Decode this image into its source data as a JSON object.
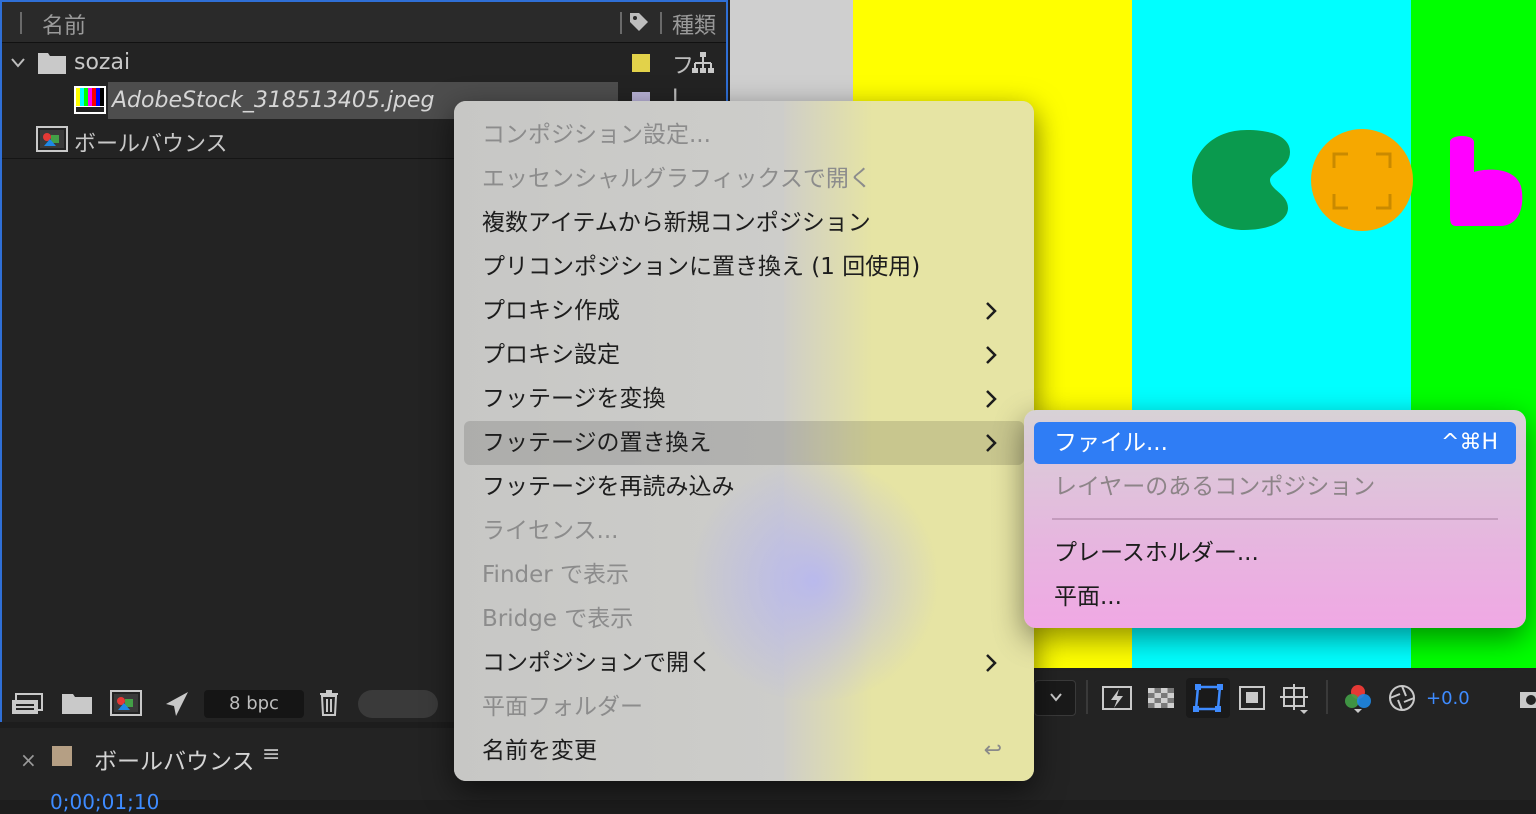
{
  "project_panel": {
    "header": {
      "name_col": "名前",
      "type_col": "種類"
    },
    "rows": [
      {
        "label": "sozai",
        "swatch": "#e2d24a"
      },
      {
        "label": "AdobeStock_318513405.jpeg",
        "swatch": "#b8b2d6"
      },
      {
        "label": "ボールバウンス"
      }
    ],
    "toolbar": {
      "bpc": "8 bpc"
    }
  },
  "timeline": {
    "close": "×",
    "title": "ボールバウンス",
    "menu": "≡",
    "time": "0;00;01;10"
  },
  "viewer": {
    "exposure": "+0.0"
  },
  "context_menu": {
    "items": [
      {
        "label": "コンポジション設定...",
        "disabled": true
      },
      {
        "label": "エッセンシャルグラフィックスで開く",
        "disabled": true
      },
      {
        "label": "複数アイテムから新規コンポジション"
      },
      {
        "label": "プリコンポジションに置き換え (1 回使用)"
      },
      {
        "label": "プロキシ作成",
        "submenu": true
      },
      {
        "label": "プロキシ設定",
        "submenu": true
      },
      {
        "label": "フッテージを変換",
        "submenu": true
      },
      {
        "label": "フッテージの置き換え",
        "submenu": true,
        "highlighted": true
      },
      {
        "label": "フッテージを再読み込み"
      },
      {
        "label": "ライセンス...",
        "disabled": true
      },
      {
        "label": "Finder で表示",
        "disabled": true
      },
      {
        "label": "Bridge で表示",
        "disabled": true
      },
      {
        "label": "コンポジションで開く",
        "submenu": true
      },
      {
        "label": "平面フォルダー",
        "disabled": true
      },
      {
        "label": "名前を変更",
        "shortcut": "↩"
      }
    ]
  },
  "submenu": {
    "items": [
      {
        "label": "ファイル...",
        "shortcut": "^⌘H",
        "active": true
      },
      {
        "label": "レイヤーのあるコンポジション",
        "disabled": true
      },
      {
        "label": "プレースホルダー..."
      },
      {
        "label": "平面..."
      }
    ]
  },
  "colors": {
    "accent": "#2f7df5",
    "panel_border": "#2f6fd6",
    "yellow": "#ffff00",
    "cyan": "#00ffff",
    "green": "#00ff00",
    "ball_green": "#0a9a4e",
    "ball_orange": "#f6a800",
    "ball_magenta": "#ff00ff"
  }
}
